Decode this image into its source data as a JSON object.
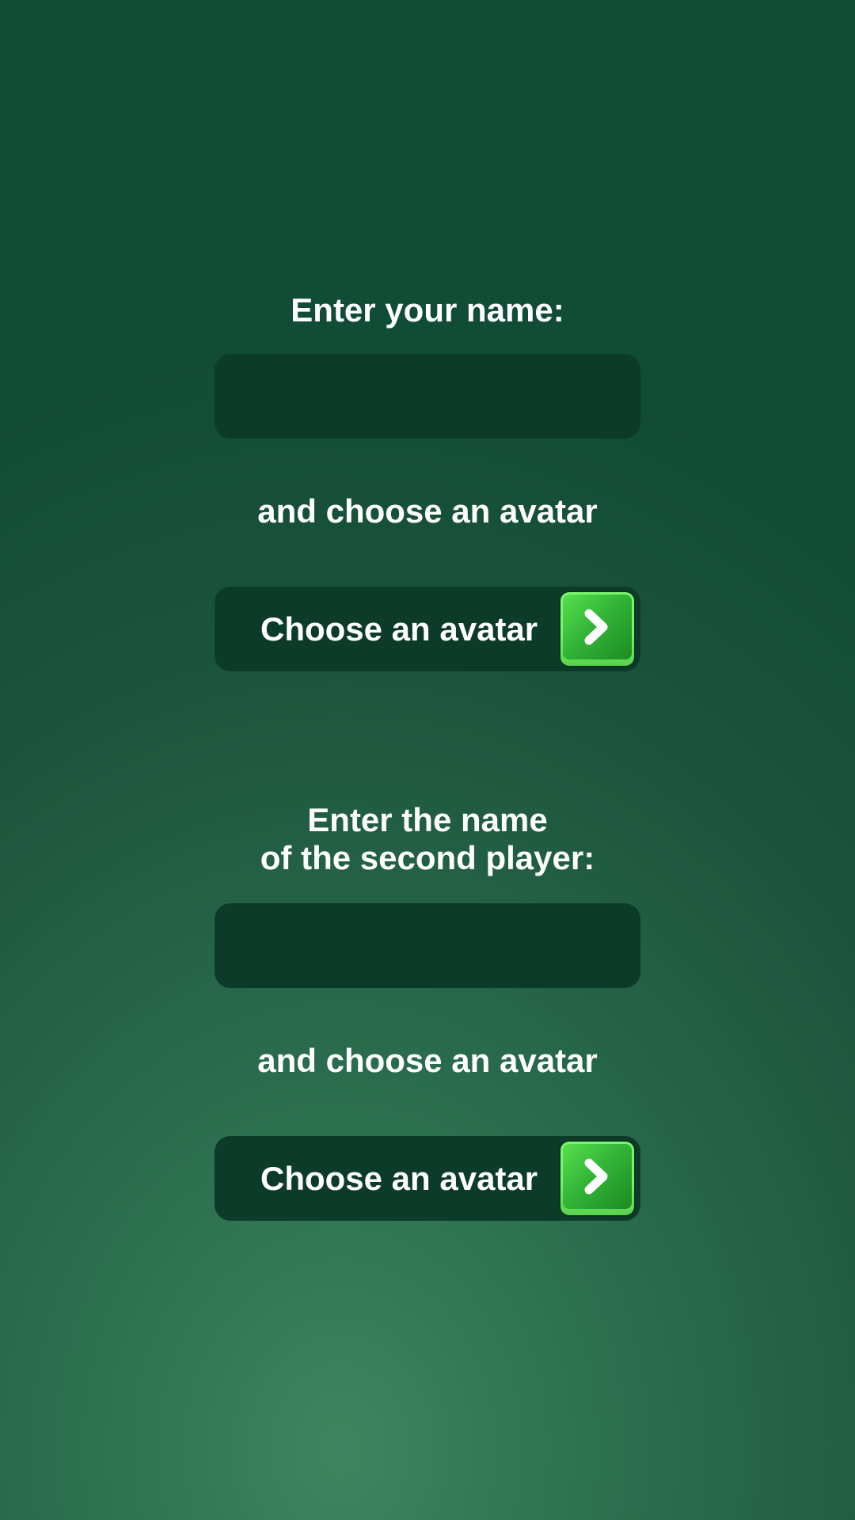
{
  "player1": {
    "heading": "Enter your name:",
    "name_input": {
      "value": "",
      "placeholder": ""
    },
    "subheading": "and choose an avatar",
    "avatar_button": {
      "label": "Choose an avatar",
      "icon": "chevron-right-icon"
    }
  },
  "player2": {
    "heading_line1": "Enter the name",
    "heading_line2": "of the second player:",
    "name_input": {
      "value": "",
      "placeholder": ""
    },
    "subheading": "and choose an avatar",
    "avatar_button": {
      "label": "Choose an avatar",
      "icon": "chevron-right-icon"
    }
  },
  "colors": {
    "background_top": "#114c36",
    "background_bottom_glow": "#3f8560",
    "field_background": "#0d3b29",
    "button_green_light": "#7bf56d",
    "button_green_dark": "#1d8a24",
    "text": "#ffffff"
  }
}
